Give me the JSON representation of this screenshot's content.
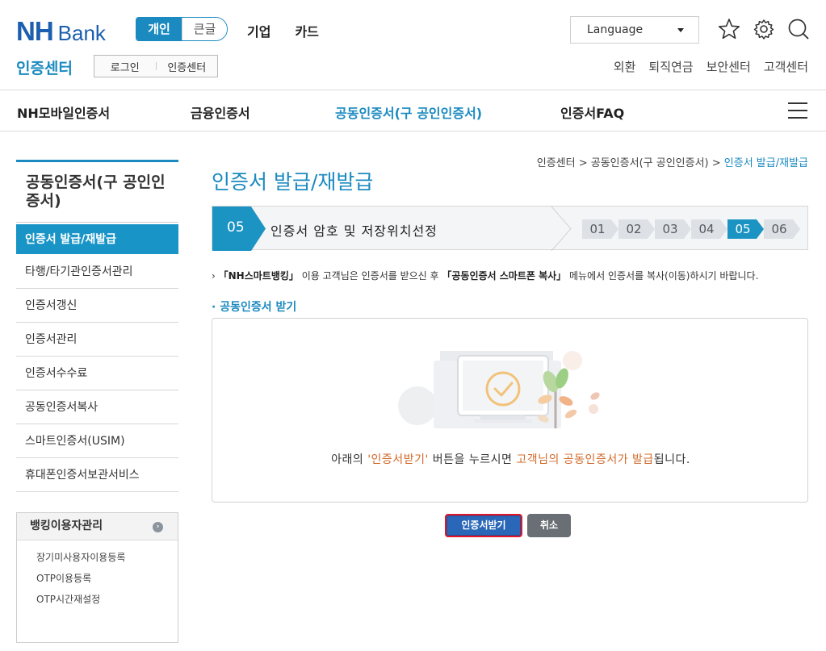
{
  "header": {
    "logo_nh": "NH",
    "logo_bank": "Bank",
    "segments": [
      "개인",
      "큰글"
    ],
    "nav": [
      "기업",
      "카드"
    ],
    "language": "Language",
    "cert_center": "인증센터",
    "sub_buttons": [
      "로그인",
      "인증센터"
    ],
    "util_links": [
      "외환",
      "퇴직연금",
      "보안센터",
      "고객센터"
    ]
  },
  "gnb": {
    "items": [
      "NH모바일인증서",
      "금융인증서",
      "공동인증서(구 공인인증서)",
      "인증서FAQ"
    ]
  },
  "sidebar": {
    "title": "공동인증서(구 공인인증서)",
    "items": [
      "인증서 발급/재발급",
      "타행/타기관인증서관리",
      "인증서갱신",
      "인증서관리",
      "인증서수수료",
      "공동인증서복사",
      "스마트인증서(USIM)",
      "휴대폰인증서보관서비스"
    ],
    "box_title": "뱅킹이용자관리",
    "box_links": [
      "장기미사용자이용등록",
      "OTP이용등록",
      "OTP시간재설정"
    ]
  },
  "breadcrumb": {
    "items": [
      "인증센터",
      "공동인증서(구 공인인증서)"
    ],
    "current": "인증서 발급/재발급",
    "separator": ">"
  },
  "page_title": "인증서 발급/재발급",
  "step": {
    "current_number": "05",
    "current_label": "인증서 암호 및 저장위치선정",
    "steps": [
      "01",
      "02",
      "03",
      "04",
      "05",
      "06"
    ],
    "active_index": 4
  },
  "notice": {
    "bullet": "›",
    "part1": "「NH스마트뱅킹」",
    "part2": " 이용 고객님은 인증서를 받으신 후 ",
    "part3": "「공동인증서 스마트폰 복사」",
    "part4": " 메뉴에서 인증서를 복사(이동)하시기 바랍니다."
  },
  "section_title": "공동인증서 받기",
  "message": {
    "pre": "아래의 ",
    "btn_ref": "'인증서받기'",
    "mid": " 버튼을 누르시면 ",
    "hl": "고객님의 공동인증서가 발급",
    "post": "됩니다."
  },
  "buttons": {
    "receive": "인증서받기",
    "cancel": "취소"
  },
  "colors": {
    "brand_blue": "#1b8ac0",
    "logo_blue": "#1b5fae",
    "highlight": "#d16a2a",
    "focus_red": "#e4152a"
  }
}
